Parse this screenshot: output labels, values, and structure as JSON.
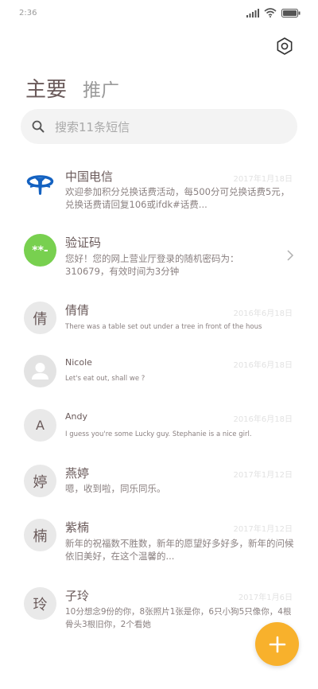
{
  "status_bar": {
    "time": "2:36",
    "icons": [
      "signal-icon",
      "wifi-icon",
      "battery-icon"
    ]
  },
  "header": {
    "settings_icon": "gear-icon"
  },
  "tabs": {
    "main": "主要",
    "promo": "推广"
  },
  "search": {
    "placeholder": "搜索11条短信",
    "icon": "search-icon"
  },
  "colors": {
    "accent": "#f8b12c",
    "telecom_blue": "#1462c1",
    "verify_green": "#78d04f"
  },
  "messages": [
    {
      "avatar_type": "telecom-logo",
      "name": "中国电信",
      "date": "2017年1月18日",
      "preview": "欢迎参加积分兑换话费活动，每500分可兑换话费5元，兑换话费请回复106或ifdk#话费..."
    },
    {
      "avatar_text": "**-",
      "name": "验证码",
      "preview": "您好！您的网上营业厅登录的随机密码为：310679，有效时间为3分钟",
      "has_chevron": true
    },
    {
      "avatar_text": "倩",
      "name": "倩倩",
      "date": "2016年6月18日",
      "preview": "There was a table set out under a tree in front of the hous"
    },
    {
      "avatar_type": "person-icon",
      "name": "Nicole",
      "date": "2016年6月18日",
      "preview": "Let's eat out, shall we ?"
    },
    {
      "avatar_text": "A",
      "name": "Andy",
      "date": "2016年6月18日",
      "preview": "I guess you're some Lucky guy. Stephanie is a nice girl."
    },
    {
      "avatar_text": "婷",
      "name": "燕婷",
      "date": "2017年1月12日",
      "preview": "嗯，收到啦，同乐同乐。"
    },
    {
      "avatar_text": "楠",
      "name": "紫楠",
      "date": "2017年1月12日",
      "preview": "新年的祝福数不胜数，新年的愿望好多好多，新年的问候依旧美好，在这个温馨的..."
    },
    {
      "avatar_text": "玲",
      "name": "子玲",
      "date": "2017年1月6日",
      "preview": "10分想念9份的你，8张照片1张是你，6只小狗5只像你，4根骨头3根旧你，2个看她"
    }
  ],
  "fab": {
    "icon": "plus-icon"
  }
}
